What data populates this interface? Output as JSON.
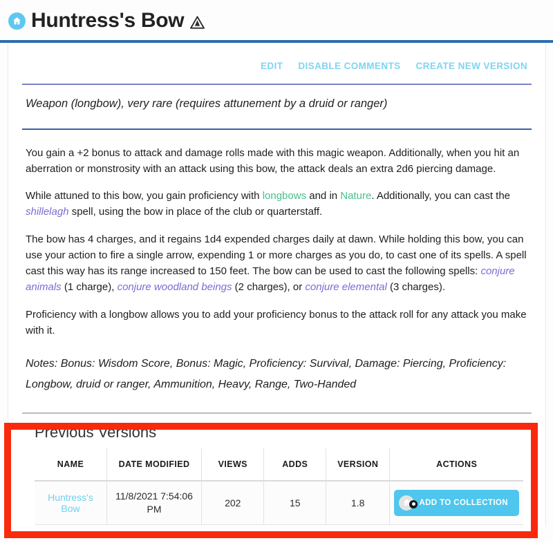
{
  "header": {
    "home_icon": "home-icon",
    "title": "Huntress's Bow",
    "warning_icon": "warning-triangle-icon"
  },
  "actions": {
    "edit": "EDIT",
    "disable_comments": "DISABLE COMMENTS",
    "create_new_version": "CREATE NEW VERSION"
  },
  "item": {
    "subtitle": "Weapon (longbow), very rare (requires attunement by a druid or ranger)",
    "paragraph_1": "You gain a +2 bonus to attack and damage rolls made with this magic weapon. Additionally, when you hit an aberration or monstrosity with an attack using this bow, the attack deals an extra 2d6 piercing damage.",
    "paragraph_2": {
      "part_1": "While attuned to this bow, you gain proficiency with ",
      "link_longbows": "longbows",
      "part_2": " and in ",
      "link_nature": "Nature",
      "part_3": ". Additionally, you can cast the ",
      "link_shillelagh": "shillelagh",
      "part_4": " spell, using the bow in place of the club or quarterstaff."
    },
    "paragraph_3": {
      "part_1": "The bow has 4 charges, and it regains 1d4 expended charges daily at dawn. While holding this bow, you can use your action to fire a single arrow, expending 1 or more charges as you do, to cast one of its spells. A spell cast this way has its range increased to 150 feet. The bow can be used to cast the following spells: ",
      "link_conjure_animals": "conjure animals",
      "part_2": " (1 charge), ",
      "link_conjure_woodland_beings": "conjure woodland beings",
      "part_3": " (2 charges), or ",
      "link_conjure_elemental": "conjure elemental",
      "part_4": " (3 charges)."
    },
    "paragraph_4": "Proficiency with a longbow allows you to add your proficiency bonus to the attack roll for any attack you make with it.",
    "notes": "Notes: Bonus: Wisdom Score, Bonus: Magic, Proficiency: Survival, Damage: Piercing, Proficiency: Longbow, druid or ranger, Ammunition, Heavy, Range, Two-Handed"
  },
  "previous_versions": {
    "title": "Previous Versions",
    "columns": [
      "NAME",
      "DATE MODIFIED",
      "VIEWS",
      "ADDS",
      "VERSION",
      "ACTIONS"
    ],
    "rows": [
      {
        "name": "Huntress's Bow",
        "date_modified": "11/8/2021 7:54:06 PM",
        "views": "202",
        "adds": "15",
        "version": "1.8",
        "action_label": "ADD TO COLLECTION",
        "action_icon": "add-to-collection-icon"
      }
    ]
  },
  "colors": {
    "accent_blue": "#4ec6ee",
    "header_rule": "#2b6cb0",
    "link_green": "#45c08a",
    "link_purple": "#7b6bd4",
    "highlight_red": "#f92a0c",
    "action_link": "#7fd4ef"
  }
}
